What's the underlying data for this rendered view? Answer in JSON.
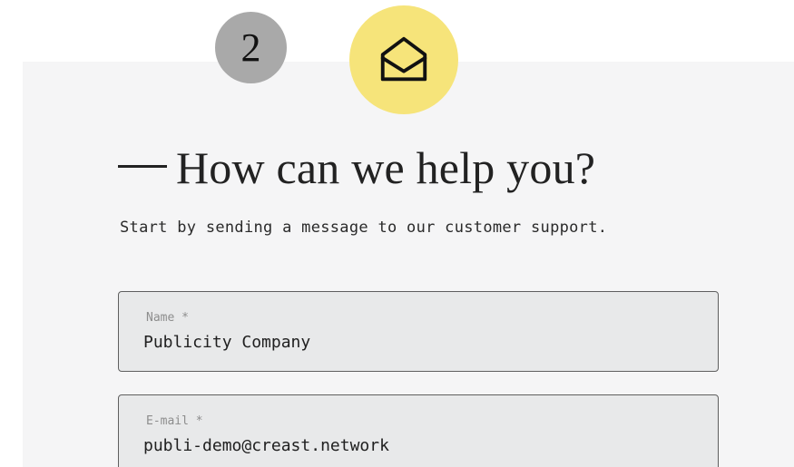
{
  "step": {
    "number": "2"
  },
  "contact": {
    "title": "How can we help you?",
    "subtitle": "Start by sending a message to our customer support."
  },
  "form": {
    "name_label": "Name *",
    "name_value": "Publicity Company",
    "email_label": "E-mail *",
    "email_value": "publi-demo@creast.network"
  },
  "icons": {
    "mail": "mail-open-icon"
  },
  "colors": {
    "page_background": "#ffffff",
    "panel_background": "#f5f5f6",
    "step_badge": "#a9a9a9",
    "mail_circle": "#f6e47a",
    "field_background": "#e8e9ea",
    "field_border": "#5f5f5f",
    "text": "#222222"
  }
}
